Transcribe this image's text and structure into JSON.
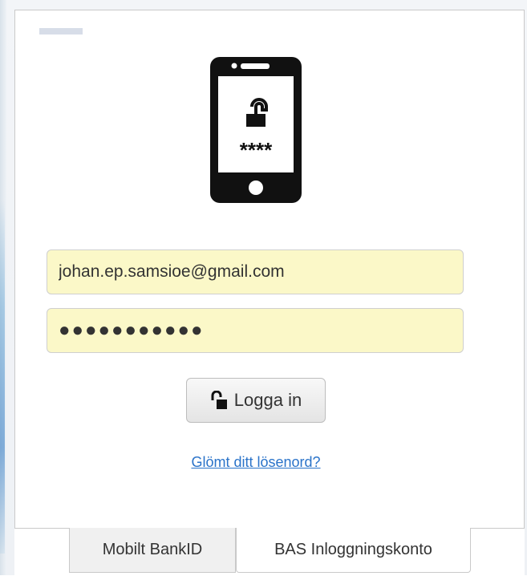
{
  "login": {
    "email_value": "johan.ep.samsioe@gmail.com",
    "password_masked": "●●●●●●●●●●●",
    "login_button_label": "Logga in",
    "forgot_password_link": "Glömt ditt lösenord?",
    "phone_icon_code": "****"
  },
  "tabs": [
    {
      "label": "Mobilt BankID",
      "selected": false
    },
    {
      "label": "BAS Inloggningskonto",
      "selected": true
    }
  ],
  "icons": {
    "phone": "smartphone-lock-icon",
    "login": "lock-open-icon"
  },
  "colors": {
    "input_background": "#fbf8c8",
    "link": "#2a73c9",
    "phone": "#111111"
  }
}
